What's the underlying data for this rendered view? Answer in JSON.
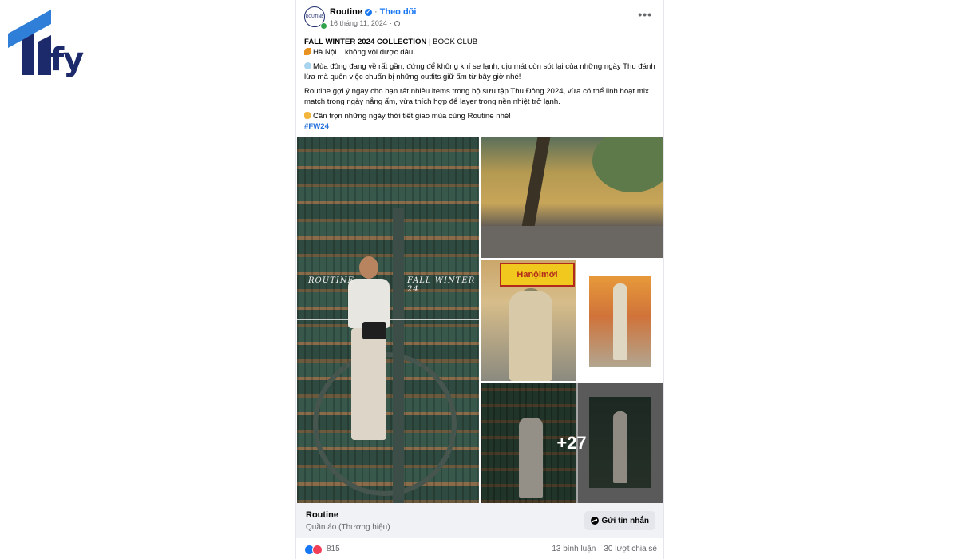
{
  "watermark": {
    "text": "ify",
    "colors": {
      "primary": "#1c2a6b",
      "accent": "#2f7fd8"
    }
  },
  "post": {
    "page_name": "Routine",
    "follow_label": "Theo dõi",
    "separator": "·",
    "date": "16 tháng 11, 2024",
    "separator2": "·",
    "avatar_text": "ROUTINE",
    "more_icon": "more-horizontal-icon",
    "paragraphs": [
      {
        "bold": "FALL WINTER 2024 COLLECTION",
        "rest": " | BOOK CLUB"
      },
      {
        "text": "Hà Nội... không vội được đâu!"
      },
      {
        "text": "Mùa đông đang về rất gần, đứng để không khí se lạnh, dịu mát còn sót lại của những ngày Thu đánh lừa mà quên việc chuẩn bị những outfits giữ ấm từ bây giờ nhé!"
      },
      {
        "text": "Routine gợi ý ngay cho bạn rất nhiều items trong bộ sưu tập Thu Đông 2024, vừa có thể linh hoạt mix match trong ngày nắng ấm, vừa thích hợp để layer trong nền nhiệt trở lạnh."
      },
      {
        "text": "Cân trọn những ngày thời tiết giao mùa cùng Routine nhé!"
      }
    ],
    "hashtag": "#FW24",
    "photo_text_left": "ROUTINE",
    "photo_text_right": "FALL WINTER 24",
    "sign_text": "Hanộimới",
    "more_photos": "+27"
  },
  "page_footer": {
    "name": "Routine",
    "category": "Quần áo (Thương hiệu)",
    "message_button": "Gửi tin nhắn"
  },
  "reactions": {
    "count": "815",
    "comments": "13 bình luận",
    "shares": "30 lượt chia sẻ"
  },
  "colors": {
    "link": "#1877f2",
    "hashtag": "#216fdb",
    "muted": "#65676b",
    "footer_bg": "#f0f2f5"
  }
}
